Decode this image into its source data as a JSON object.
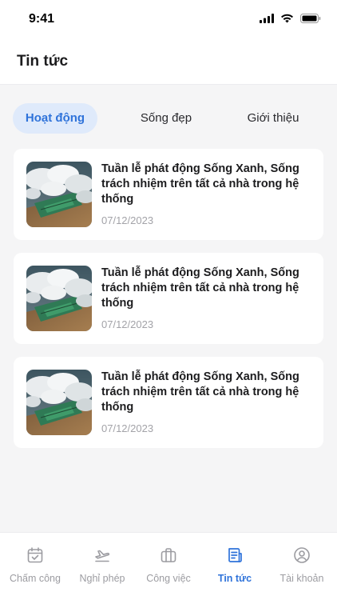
{
  "status_bar": {
    "time": "9:41"
  },
  "header": {
    "title": "Tin tức"
  },
  "tabs": [
    {
      "label": "Hoạt động",
      "active": true
    },
    {
      "label": "Sống đẹp",
      "active": false
    },
    {
      "label": "Giới thiệu",
      "active": false
    }
  ],
  "news": [
    {
      "title": "Tuần lễ phát động Sống Xanh, Sống trách nhiệm trên tất cả nhà trong hệ thống",
      "date": "07/12/2023"
    },
    {
      "title": "Tuần lễ phát động Sống Xanh, Sống trách nhiệm trên tất cả nhà trong hệ thống",
      "date": "07/12/2023"
    },
    {
      "title": "Tuần lễ phát động Sống Xanh, Sống trách nhiệm trên tất cả nhà trong hệ thống",
      "date": "07/12/2023"
    }
  ],
  "bottom_nav": [
    {
      "label": "Chấm công",
      "icon": "calendar-check-icon",
      "active": false
    },
    {
      "label": "Nghỉ phép",
      "icon": "plane-icon",
      "active": false
    },
    {
      "label": "Công việc",
      "icon": "briefcase-icon",
      "active": false
    },
    {
      "label": "Tin tức",
      "icon": "news-icon",
      "active": true
    },
    {
      "label": "Tài khoản",
      "icon": "user-circle-icon",
      "active": false
    }
  ],
  "colors": {
    "accent": "#2f73da",
    "tab_active_bg": "#dfeafb",
    "muted": "#9c9ca1"
  }
}
